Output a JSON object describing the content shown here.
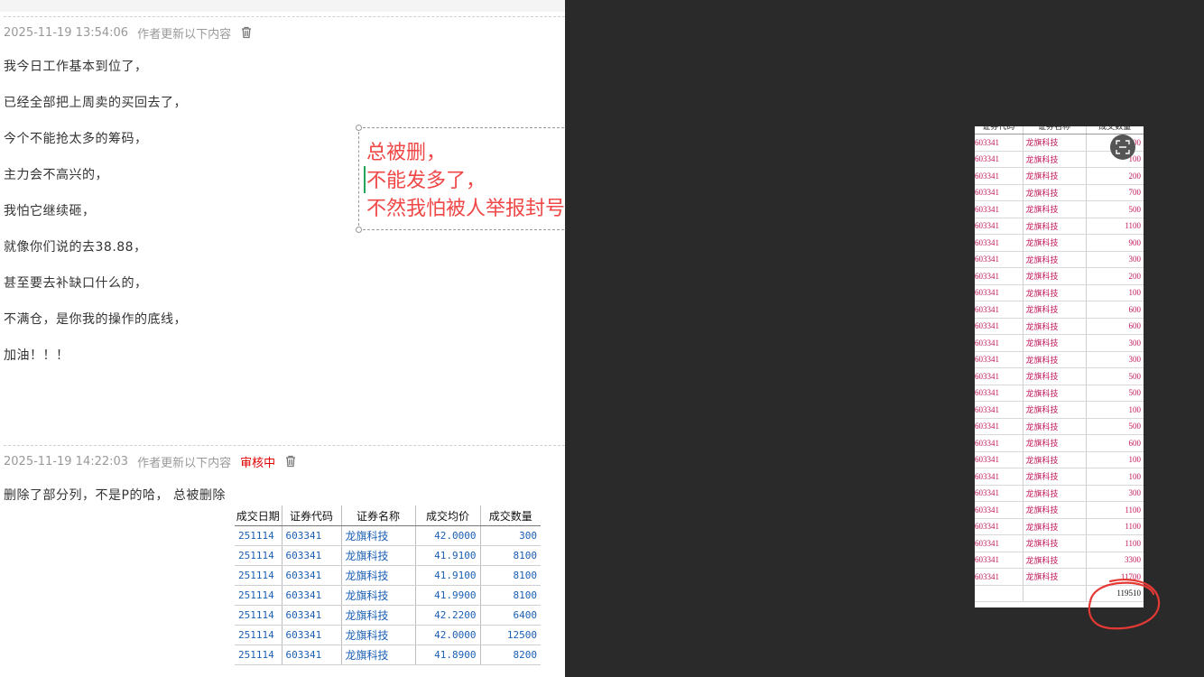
{
  "posts": [
    {
      "timestamp": "2025-11-19 13:54:06",
      "meta_label": "作者更新以下内容",
      "lines": [
        "我今日工作基本到位了，",
        "已经全部把上周卖的买回去了，",
        "今个不能抢太多的筹码，",
        "主力会不高兴的，",
        "我怕它继续砸，",
        "就像你们说的去38.88，",
        "甚至要去补缺口什么的，",
        "不满仓，是你我的操作的底线，",
        "加油！！！"
      ]
    },
    {
      "timestamp": "2025-11-19 14:22:03",
      "meta_label": "作者更新以下内容",
      "status": "审核中",
      "lines": [
        "删除了部分列，不是P的哈， 总被删除"
      ]
    }
  ],
  "annotation": {
    "lines": [
      "总被删，",
      "不能发多了，",
      "不然我怕被人举报封号"
    ],
    "color": "#f04747"
  },
  "trade_table": {
    "headers": [
      "成交日期",
      "证券代码",
      "证券名称",
      "成交均价",
      "成交数量"
    ],
    "rows": [
      [
        "251114",
        "603341",
        "龙旗科技",
        "42.0000",
        "300"
      ],
      [
        "251114",
        "603341",
        "龙旗科技",
        "41.9100",
        "8100"
      ],
      [
        "251114",
        "603341",
        "龙旗科技",
        "41.9100",
        "8100"
      ],
      [
        "251114",
        "603341",
        "龙旗科技",
        "41.9900",
        "8100"
      ],
      [
        "251114",
        "603341",
        "龙旗科技",
        "42.2200",
        "6400"
      ],
      [
        "251114",
        "603341",
        "龙旗科技",
        "42.0000",
        "12500"
      ],
      [
        "251114",
        "603341",
        "龙旗科技",
        "41.8900",
        "8200"
      ]
    ]
  },
  "image_table": {
    "headers": [
      "证券代码",
      "证券名称",
      "成交数量"
    ],
    "code": "603341",
    "name": "龙旗科技",
    "quantities": [
      "100",
      "100",
      "200",
      "700",
      "500",
      "1100",
      "900",
      "300",
      "200",
      "100",
      "600",
      "600",
      "300",
      "300",
      "500",
      "500",
      "100",
      "500",
      "600",
      "100",
      "100",
      "300",
      "1100",
      "1100",
      "1100",
      "3300",
      "11700"
    ],
    "total": "119510"
  },
  "colors": {
    "dark_panel": "#2a2a2a",
    "status_red": "#e00000",
    "table_blue": "#1a5fb4",
    "image_red": "#c2185b"
  }
}
